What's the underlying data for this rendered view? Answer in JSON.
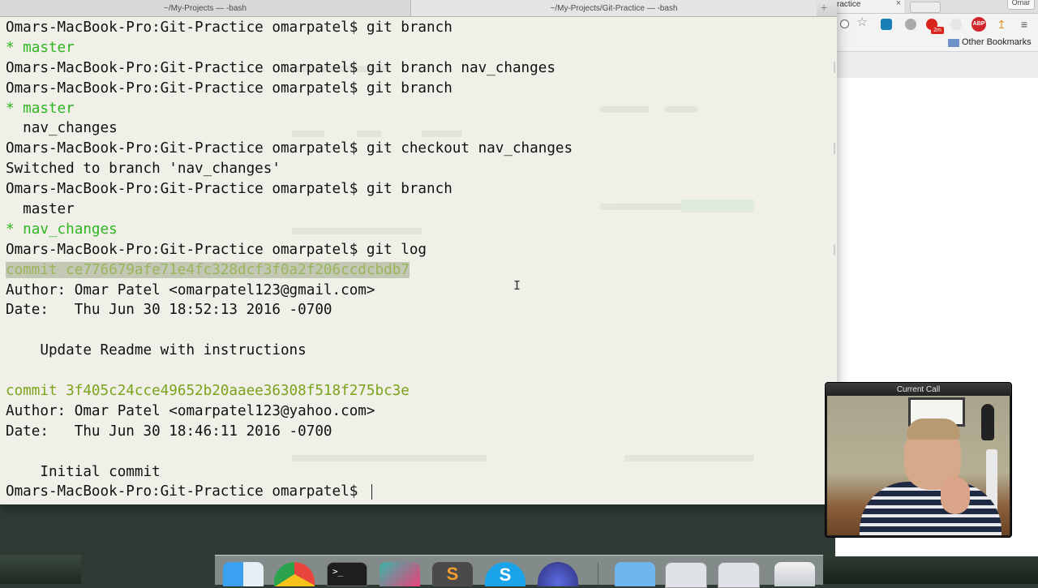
{
  "terminal": {
    "tabs": [
      "~/My-Projects — -bash",
      "~/My-Projects/Git-Practice — -bash"
    ],
    "new_tab_symbol": "+",
    "lines": [
      {
        "segments": [
          {
            "text": "Omars-MacBook-Pro:Git-Practice omarpatel$ git branch",
            "style": "plain"
          }
        ]
      },
      {
        "segments": [
          {
            "text": "* master",
            "style": "green"
          }
        ]
      },
      {
        "segments": [
          {
            "text": "Omars-MacBook-Pro:Git-Practice omarpatel$ git branch nav_changes",
            "style": "plain"
          }
        ]
      },
      {
        "segments": [
          {
            "text": "Omars-MacBook-Pro:Git-Practice omarpatel$ git branch",
            "style": "plain"
          }
        ]
      },
      {
        "segments": [
          {
            "text": "* master",
            "style": "green"
          }
        ]
      },
      {
        "segments": [
          {
            "text": "  nav_changes",
            "style": "plain"
          }
        ]
      },
      {
        "segments": [
          {
            "text": "Omars-MacBook-Pro:Git-Practice omarpatel$ git checkout nav_changes",
            "style": "plain"
          }
        ]
      },
      {
        "segments": [
          {
            "text": "Switched to branch 'nav_changes'",
            "style": "plain"
          }
        ]
      },
      {
        "segments": [
          {
            "text": "Omars-MacBook-Pro:Git-Practice omarpatel$ git branch",
            "style": "plain"
          }
        ]
      },
      {
        "segments": [
          {
            "text": "  master",
            "style": "plain"
          }
        ]
      },
      {
        "segments": [
          {
            "text": "* nav_changes",
            "style": "green"
          }
        ]
      },
      {
        "segments": [
          {
            "text": "Omars-MacBook-Pro:Git-Practice omarpatel$ git log",
            "style": "plain"
          }
        ]
      },
      {
        "segments": [
          {
            "text": "commit ce776679afe71e4fc328dcf3f0a2f206ccdcbdb7",
            "style": "selected"
          }
        ]
      },
      {
        "segments": [
          {
            "text": "Author: Omar Patel <omarpatel123@gmail.com>",
            "style": "plain"
          }
        ]
      },
      {
        "segments": [
          {
            "text": "Date:   Thu Jun 30 18:52:13 2016 -0700",
            "style": "plain"
          }
        ]
      },
      {
        "segments": [
          {
            "text": "",
            "style": "plain"
          }
        ]
      },
      {
        "segments": [
          {
            "text": "    Update Readme with instructions",
            "style": "plain"
          }
        ]
      },
      {
        "segments": [
          {
            "text": "",
            "style": "plain"
          }
        ]
      },
      {
        "segments": [
          {
            "text": "commit 3f405c24cce49652b20aaee36308f518f275bc3e",
            "style": "olive"
          }
        ]
      },
      {
        "segments": [
          {
            "text": "Author: Omar Patel <omarpatel123@yahoo.com>",
            "style": "plain"
          }
        ]
      },
      {
        "segments": [
          {
            "text": "Date:   Thu Jun 30 18:46:11 2016 -0700",
            "style": "plain"
          }
        ]
      },
      {
        "segments": [
          {
            "text": "",
            "style": "plain"
          }
        ]
      },
      {
        "segments": [
          {
            "text": "    Initial commit",
            "style": "plain"
          }
        ]
      },
      {
        "segments": [
          {
            "text": "Omars-MacBook-Pro:Git-Practice omarpatel$ ",
            "style": "prompt-cursor"
          }
        ]
      }
    ],
    "colors": {
      "green": "#2fb521",
      "olive": "#7aa31a",
      "selection": "#c2c8b4"
    }
  },
  "browser": {
    "tab_title": "ractice",
    "close_symbol": "×",
    "user_button": "Omar",
    "bookmarks_label": "Other Bookmarks",
    "extension_icons": [
      "search-icon",
      "star-icon",
      "app-icon",
      "profile-icon",
      "notification-badge-icon",
      "sync-icon",
      "adblock-icon",
      "pin-icon",
      "menu-icon"
    ],
    "badge_text": "2m",
    "adblock_text": "ABP"
  },
  "call": {
    "title": "Current Call"
  },
  "dock": {
    "apps": [
      "finder-icon",
      "chrome-icon",
      "terminal-icon",
      "slack-icon",
      "sublime-icon",
      "skype-icon",
      "browser-icon",
      "folder-icon",
      "screenshot-icon",
      "screenshot-icon",
      "trash-icon"
    ],
    "terminal_glyph": ">_",
    "sublime_glyph": "S",
    "skype_glyph": "S"
  }
}
